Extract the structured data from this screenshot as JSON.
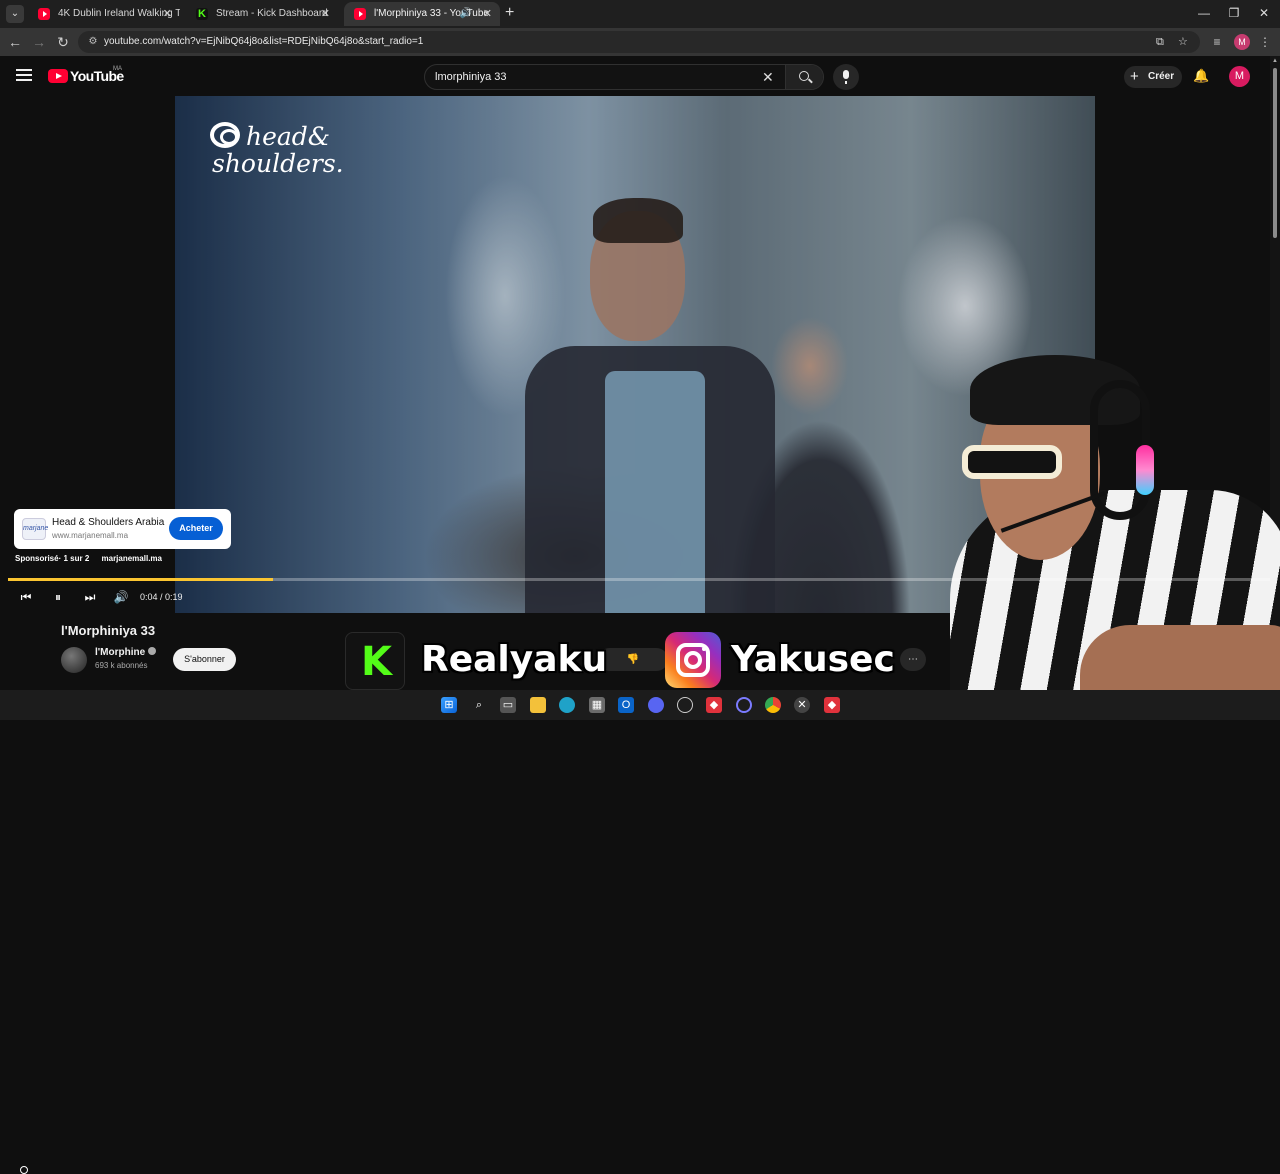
{
  "browser": {
    "tabs": [
      {
        "title": "4K Dublin Ireland Walking To",
        "favicon": "youtube-icon"
      },
      {
        "title": "Stream - Kick Dashboard",
        "favicon": "kick-icon"
      },
      {
        "title": "l'Morphiniya 33 - YouTube",
        "favicon": "youtube-icon",
        "active": true,
        "audio": true
      }
    ],
    "url": "youtube.com/watch?v=EjNibQ64j8o&list=RDEjNibQ64j8o&start_radio=1",
    "profile_initial": "M"
  },
  "youtube": {
    "logo_text": "YouTube",
    "country_code": "MA",
    "search_value": "lmorphiniya 33",
    "create_label": "Créer",
    "avatar_initial": "M"
  },
  "ad": {
    "brand_line1": "head&",
    "brand_line2": "shoulders.",
    "advertiser": "Head & Shoulders Arabia",
    "url": "www.marjanemall.ma",
    "thumb_text": "marjane",
    "cta": "Acheter",
    "sponsored_label": "Sponsorisé",
    "count": "1 sur 2",
    "domain": "marjanemall.ma",
    "progress": 0.21
  },
  "player": {
    "time": "0:04 / 0:19"
  },
  "video": {
    "title": "l'Morphiniya 33",
    "channel": "l'Morphine",
    "subscribers": "693 k abonnés",
    "subscribe_label": "S'abonner"
  },
  "overlay": {
    "kick_letter": "K",
    "kick_name": "Realyaku",
    "instagram_name": "Yakusec"
  },
  "colors": {
    "youtube_red": "#ff0033",
    "kick_green": "#53fc18",
    "ad_cta_blue": "#065fd4",
    "ad_progress_yellow": "#fbc531"
  }
}
